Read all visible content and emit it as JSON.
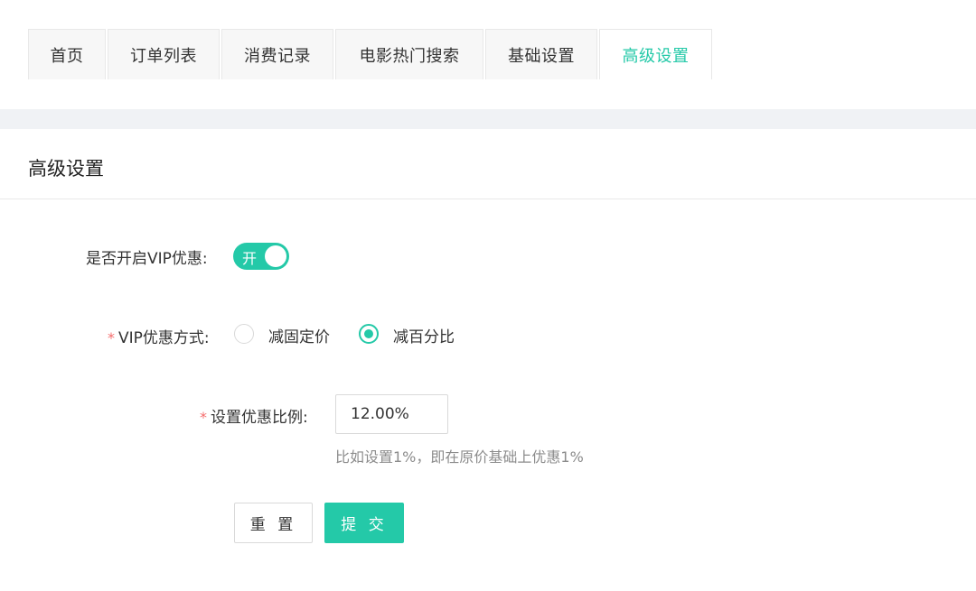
{
  "tabs": [
    {
      "label": "首页",
      "active": false
    },
    {
      "label": "订单列表",
      "active": false
    },
    {
      "label": "消费记录",
      "active": false
    },
    {
      "label": "电影热门搜索",
      "active": false
    },
    {
      "label": "基础设置",
      "active": false
    },
    {
      "label": "高级设置",
      "active": true
    }
  ],
  "card": {
    "title": "高级设置"
  },
  "form": {
    "vip_toggle": {
      "label": "是否开启VIP优惠:",
      "on_text": "开",
      "enabled": true
    },
    "vip_mode": {
      "required_mark": "*",
      "label": "VIP优惠方式:",
      "options": [
        {
          "label": "减固定价",
          "selected": false
        },
        {
          "label": "减百分比",
          "selected": true
        }
      ]
    },
    "discount": {
      "required_mark": "*",
      "label": "设置优惠比例:",
      "value": "12.00%",
      "hint": "比如设置1%，即在原价基础上优惠1%"
    },
    "buttons": {
      "reset": "重 置",
      "submit": "提 交"
    }
  },
  "colors": {
    "accent": "#24c9a8",
    "required": "#f56c6c",
    "page_gap": "#f0f2f5"
  }
}
